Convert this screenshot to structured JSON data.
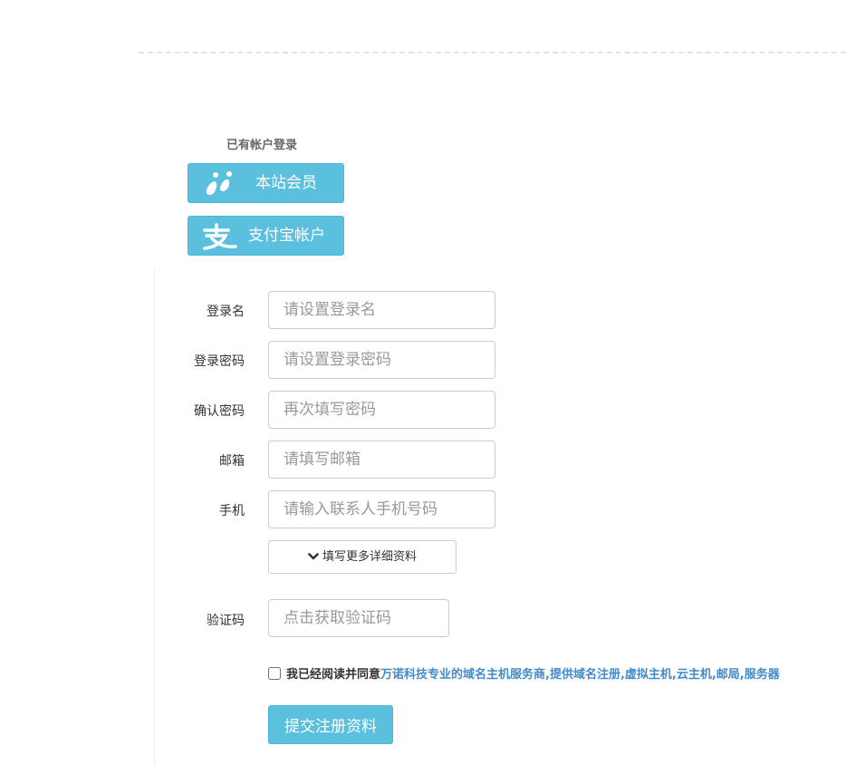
{
  "login_section": {
    "title": "已有帐户登录",
    "buttons": [
      {
        "label": "本站会员",
        "icon": "member-feet-icon"
      },
      {
        "label": "支付宝帐户",
        "icon": "alipay-icon"
      }
    ]
  },
  "form": {
    "fields": [
      {
        "label": "登录名",
        "placeholder": "请设置登录名",
        "value": ""
      },
      {
        "label": "登录密码",
        "placeholder": "请设置登录密码",
        "value": ""
      },
      {
        "label": "确认密码",
        "placeholder": "再次填写密码",
        "value": ""
      },
      {
        "label": "邮箱",
        "placeholder": "请填写邮箱",
        "value": ""
      },
      {
        "label": "手机",
        "placeholder": "请输入联系人手机号码",
        "value": ""
      }
    ],
    "more_button_label": "填写更多详细资料",
    "captcha": {
      "label": "验证码",
      "placeholder": "点击获取验证码",
      "value": ""
    },
    "agreement": {
      "checked": false,
      "text": "我已经阅读并同意",
      "link_text": "万诺科技专业的域名主机服务商,提供域名注册,虚拟主机,云主机,邮局,服务器"
    },
    "submit_label": "提交注册资料"
  },
  "colors": {
    "accent": "#5bc0de",
    "link": "#428bca"
  }
}
